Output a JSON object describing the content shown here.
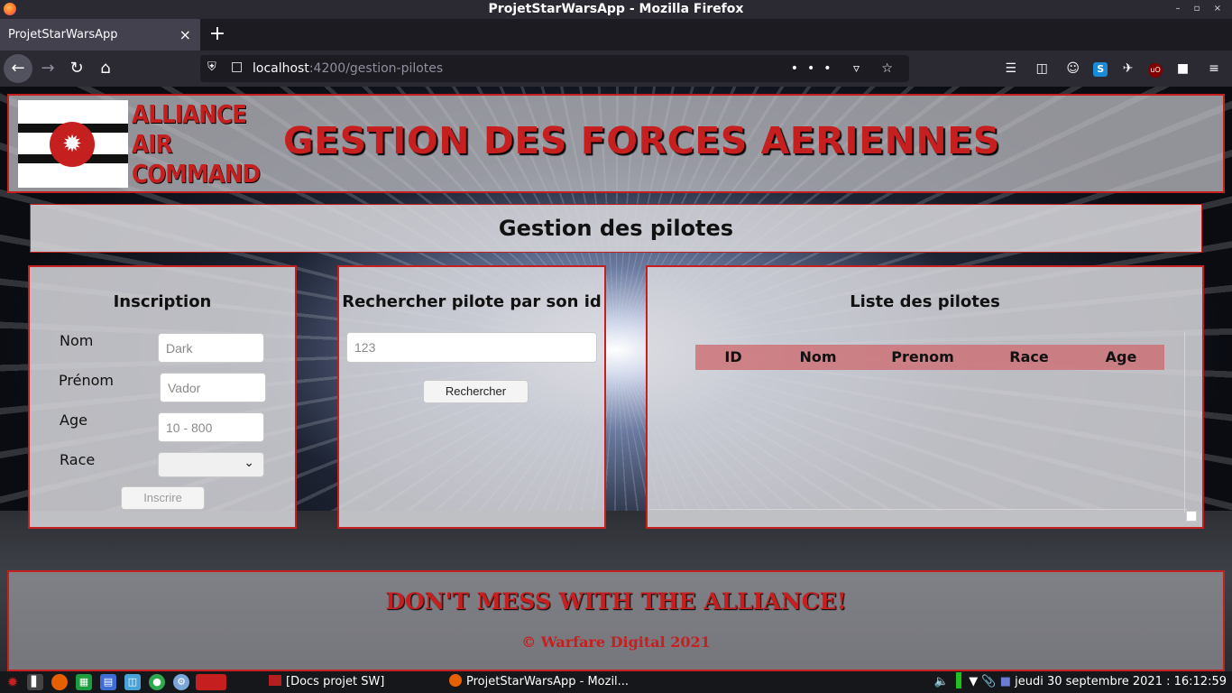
{
  "window": {
    "title": "ProjetStarWarsApp - Mozilla Firefox",
    "controls": "– ▫ ×"
  },
  "browser": {
    "tab_title": "ProjetStarWarsApp",
    "tab_close": "×",
    "new_tab": "+",
    "url_host": "localhost",
    "url_path": ":4200/gestion-pilotes",
    "url_actions": "••• ▿ ☆"
  },
  "header": {
    "logo_lines": [
      "ALLIANCE",
      "AIR",
      "COMMAND"
    ],
    "banner": "GESTION DES FORCES AERIENNES",
    "accent_color": "#c61f1f"
  },
  "page_title": "Gestion des pilotes",
  "inscription": {
    "title": "Inscription",
    "fields": [
      {
        "label": "Nom",
        "placeholder": "Dark"
      },
      {
        "label": "Prénom",
        "placeholder": "Vador"
      },
      {
        "label": "Age",
        "placeholder": "10 - 800"
      },
      {
        "label": "Race",
        "selected": ""
      }
    ],
    "submit_label": "Inscrire"
  },
  "search": {
    "title": "Rechercher pilote par son id",
    "placeholder": "123",
    "button_label": "Rechercher"
  },
  "list": {
    "title": "Liste des pilotes",
    "columns": [
      "ID",
      "Nom",
      "Prenom",
      "Race",
      "Age"
    ],
    "rows": []
  },
  "footer": {
    "slogan": "DON'T MESS WITH THE ALLIANCE!",
    "copyright": "© Warfare Digital 2021"
  },
  "taskbar": {
    "task_docs": "[Docs projet SW]",
    "task_firefox": "ProjetStarWarsApp - Mozil...",
    "clock": "jeudi 30 septembre 2021 : 16:12:59"
  }
}
